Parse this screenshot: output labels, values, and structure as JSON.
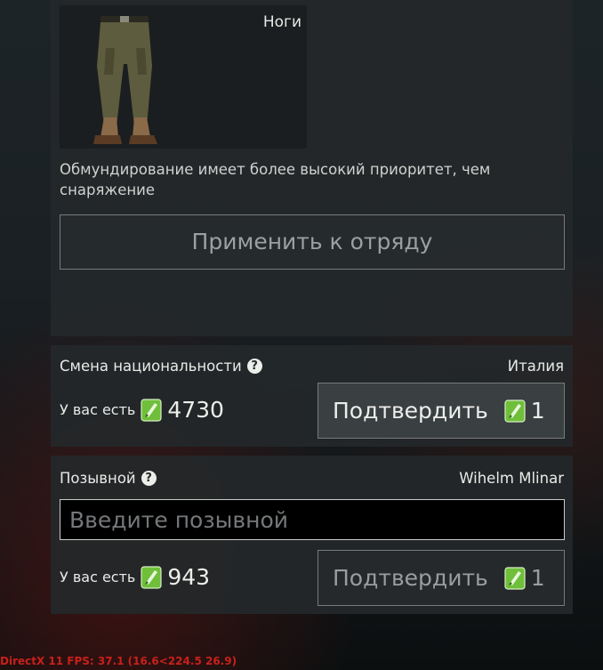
{
  "item": {
    "slot_label": "Ноги",
    "image": "pants-icon"
  },
  "priority_note": "Обмундирование имеет более высокий приоритет, чем снаряжение",
  "apply_button": "Применить к отряду",
  "nationality": {
    "title": "Смена национальности",
    "value": "Италия",
    "balance_label": "У вас есть",
    "balance": "4730",
    "confirm_label": "Подтвердить",
    "cost": "1",
    "icon": "ticket-icon"
  },
  "callsign": {
    "title": "Позывной",
    "value": "Wihelm Mlinar",
    "placeholder": "Введите позывной",
    "balance_label": "У вас есть",
    "balance": "943",
    "confirm_label": "Подтвердить",
    "cost": "1",
    "icon": "ticket-icon"
  },
  "colors": {
    "ticket_green": "#6fbf3a",
    "fps_red": "#c8201b"
  },
  "fps_overlay": "DirectX 11 FPS: 37.1 (16.6<224.5 26.9)"
}
